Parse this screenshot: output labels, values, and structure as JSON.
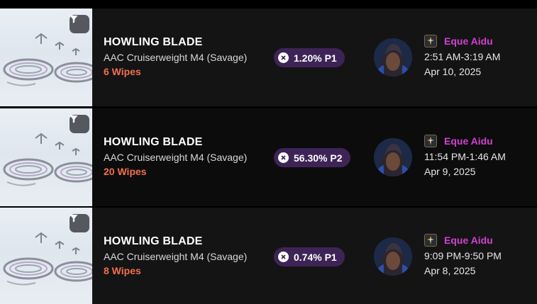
{
  "colors": {
    "wipes": "#f0704e",
    "character_name": "#d23fd0",
    "badge_bg": "#3e2456",
    "filter_button": "#55585e"
  },
  "icons": {
    "filter": "filter-funnel-icon",
    "wipe": "x-circle-icon",
    "job": "astrologian-job-icon"
  },
  "rows": [
    {
      "boss": "HOWLING BLADE",
      "zone": "AAC Cruiserweight M4 (Savage)",
      "wipes": "6 Wipes",
      "best_pull": "1.20% P1",
      "character": "Eque Aidu",
      "time": "2:51 AM-3:19 AM",
      "date": "Apr 10, 2025"
    },
    {
      "boss": "HOWLING BLADE",
      "zone": "AAC Cruiserweight M4 (Savage)",
      "wipes": "20 Wipes",
      "best_pull": "56.30% P2",
      "character": "Eque Aidu",
      "time": "11:54 PM-1:46 AM",
      "date": "Apr 9, 2025"
    },
    {
      "boss": "HOWLING BLADE",
      "zone": "AAC Cruiserweight M4 (Savage)",
      "wipes": "8 Wipes",
      "best_pull": "0.74% P1",
      "character": "Eque Aidu",
      "time": "9:09 PM-9:50 PM",
      "date": "Apr 8, 2025"
    }
  ]
}
